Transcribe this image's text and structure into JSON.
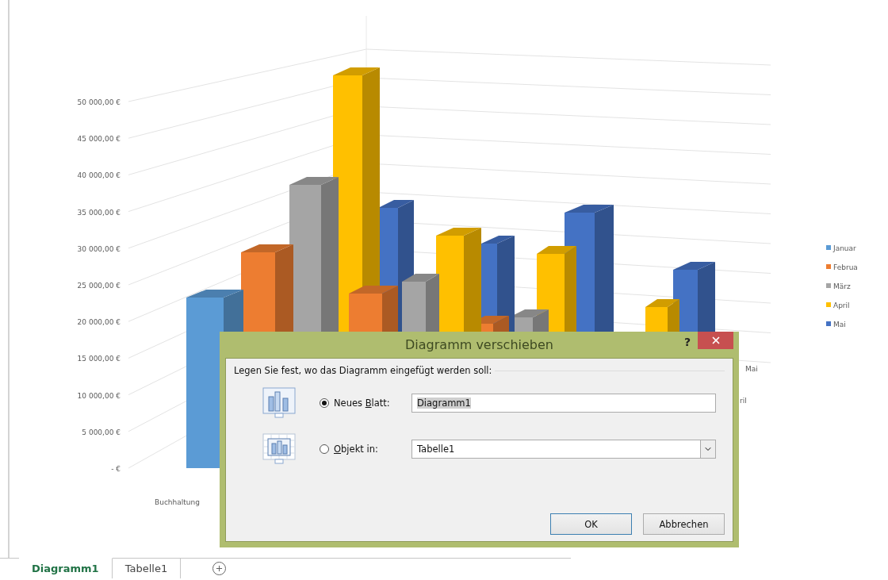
{
  "chart": {
    "y_axis_labels": [
      "50 000,00 €",
      "45 000,00 €",
      "40 000,00 €",
      "35 000,00 €",
      "30 000,00 €",
      "25 000,00 €",
      "20 000,00 €",
      "15 000,00 €",
      "10 000,00 €",
      "5 000,00 €",
      "- €"
    ],
    "category_labels": [
      "Buchhaltung",
      "Mai",
      "ril"
    ],
    "legend": [
      {
        "label": "Januar",
        "color": "#5b9bd5"
      },
      {
        "label": "Februa",
        "color": "#ed7d31"
      },
      {
        "label": "März",
        "color": "#a5a5a5"
      },
      {
        "label": "April",
        "color": "#ffc000"
      },
      {
        "label": "Mai",
        "color": "#4472c4"
      }
    ]
  },
  "dialog": {
    "title": "Diagramm verschieben",
    "help": "?",
    "prompt": "Legen Sie fest, wo das Diagramm eingefügt werden soll:",
    "options": [
      {
        "kind": "text",
        "label_before": "Neues ",
        "access_key": "B",
        "label_after": "latt:",
        "selected": true,
        "value": "Diagramm1"
      },
      {
        "kind": "dropdown",
        "access_key": "O",
        "label_after": "bjekt in:",
        "selected": false,
        "value": "Tabelle1"
      }
    ],
    "buttons": [
      {
        "label": "OK",
        "default": true
      },
      {
        "label": "Abbrechen",
        "default": false
      }
    ]
  },
  "sheet_tabs": [
    {
      "label": "Diagramm1",
      "selected": true
    },
    {
      "label": "Tabelle1",
      "selected": false
    }
  ]
}
